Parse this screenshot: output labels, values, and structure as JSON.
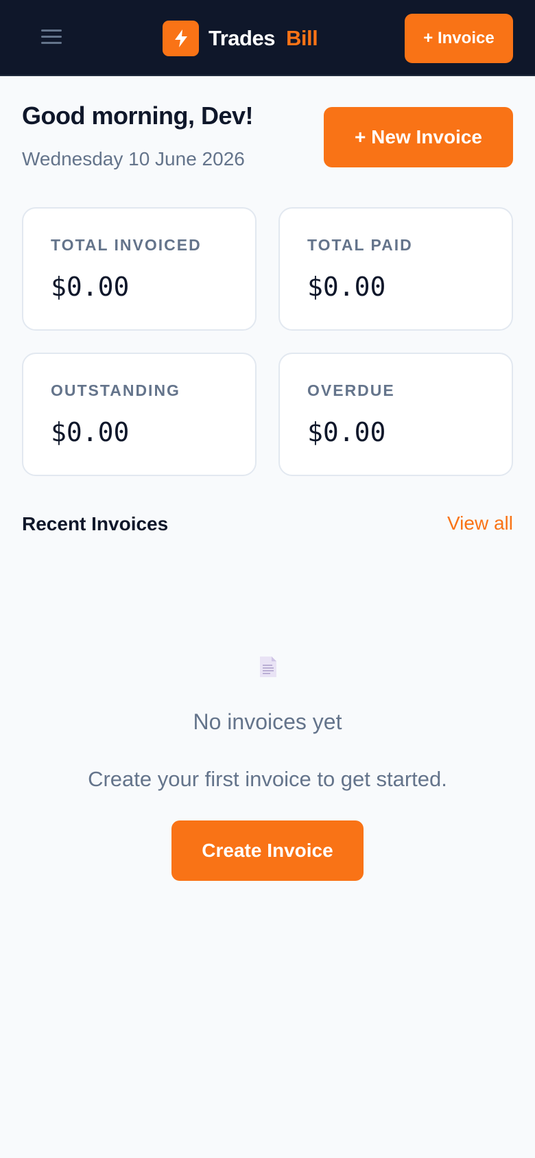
{
  "header": {
    "brand_primary": "Trades",
    "brand_accent": "Bill",
    "invoice_button": "+ Invoice",
    "menu_icon": "hamburger-icon",
    "logo_icon": "lightning-bolt-icon"
  },
  "greeting": {
    "title": "Good morning, Dev!",
    "date": "Wednesday 10 June 2026",
    "new_invoice_button": "+ New Invoice"
  },
  "stats": [
    {
      "label": "TOTAL INVOICED",
      "value": "$0.00"
    },
    {
      "label": "TOTAL PAID",
      "value": "$0.00"
    },
    {
      "label": "OUTSTANDING",
      "value": "$0.00"
    },
    {
      "label": "OVERDUE",
      "value": "$0.00"
    }
  ],
  "recent": {
    "title": "Recent Invoices",
    "view_all": "View all",
    "empty_icon": "document-icon",
    "empty_title": "No invoices yet",
    "empty_subtitle": "Create your first invoice to get started.",
    "create_button": "Create Invoice"
  },
  "colors": {
    "accent": "#f97316",
    "header_bg": "#0f172a",
    "page_bg": "#f8fafc",
    "muted_text": "#64748b"
  }
}
